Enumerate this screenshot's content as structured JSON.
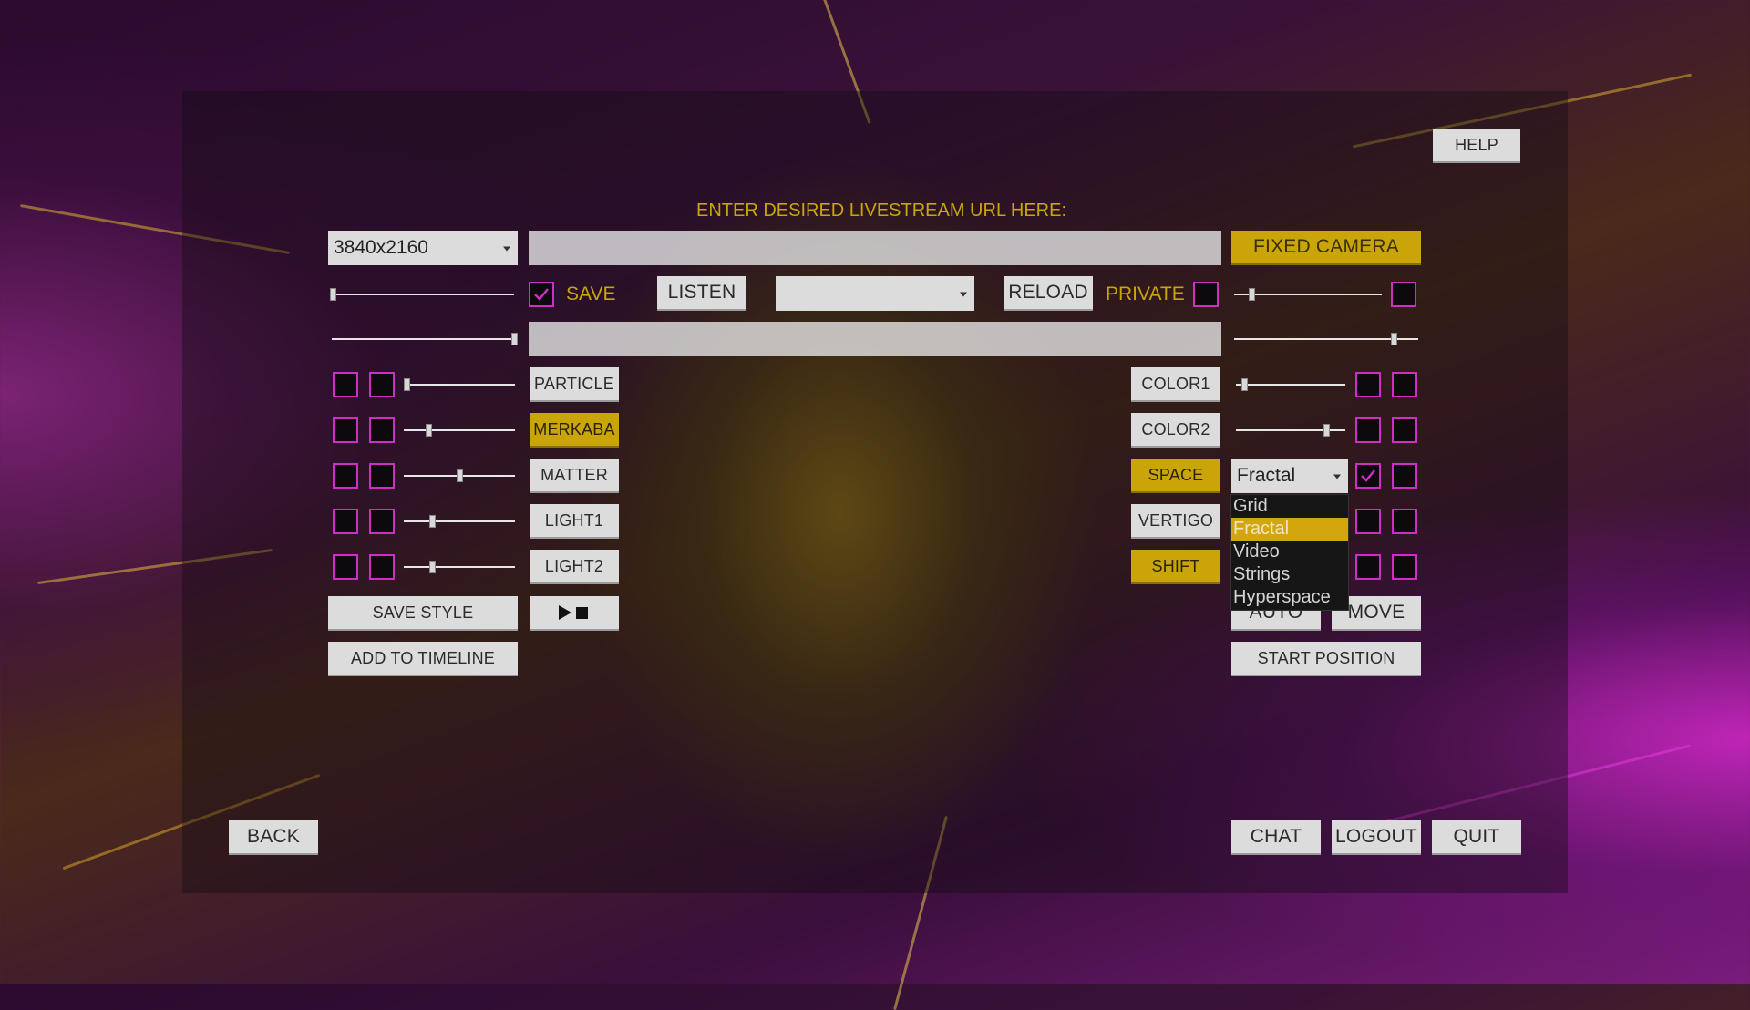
{
  "help": "HELP",
  "url_prompt": "ENTER DESIRED LIVESTREAM URL HERE:",
  "resolution": "3840x2160",
  "url_value": "",
  "second_field_value": "",
  "fixed_camera": "FIXED CAMERA",
  "save_label": "SAVE",
  "listen": "LISTEN",
  "audio_select_value": "",
  "reload": "RELOAD",
  "private_label": "PRIVATE",
  "left_effects": [
    "PARTICLE",
    "MERKABA",
    "MATTER",
    "LIGHT1",
    "LIGHT2"
  ],
  "right_effects": [
    "COLOR1",
    "COLOR2",
    "SPACE",
    "VERTIGO",
    "SHIFT"
  ],
  "space_mode": {
    "selected": "Fractal",
    "options": [
      "Grid",
      "Fractal",
      "Video",
      "Strings",
      "Hyperspace"
    ]
  },
  "save_style": "SAVE STYLE",
  "add_to_timeline": "ADD TO TIMELINE",
  "auto": "AUTO",
  "move": "MOVE",
  "start_position": "START POSITION",
  "back": "BACK",
  "chat": "CHAT",
  "logout": "LOGOUT",
  "quit": "QUIT",
  "left_slider_levels": [
    0.05,
    0.2,
    0.5,
    0.25,
    0.25
  ],
  "right_slider_levels": [
    0.05,
    0.8
  ],
  "top_left_slider_level": 0.0,
  "second_left_slider_level": 1.0,
  "top_right_slider_level": 0.1,
  "second_right_slider_level": 0.85,
  "colors": {
    "accent_gold": "#c9a509",
    "checkbox_magenta": "#d02cc8"
  }
}
